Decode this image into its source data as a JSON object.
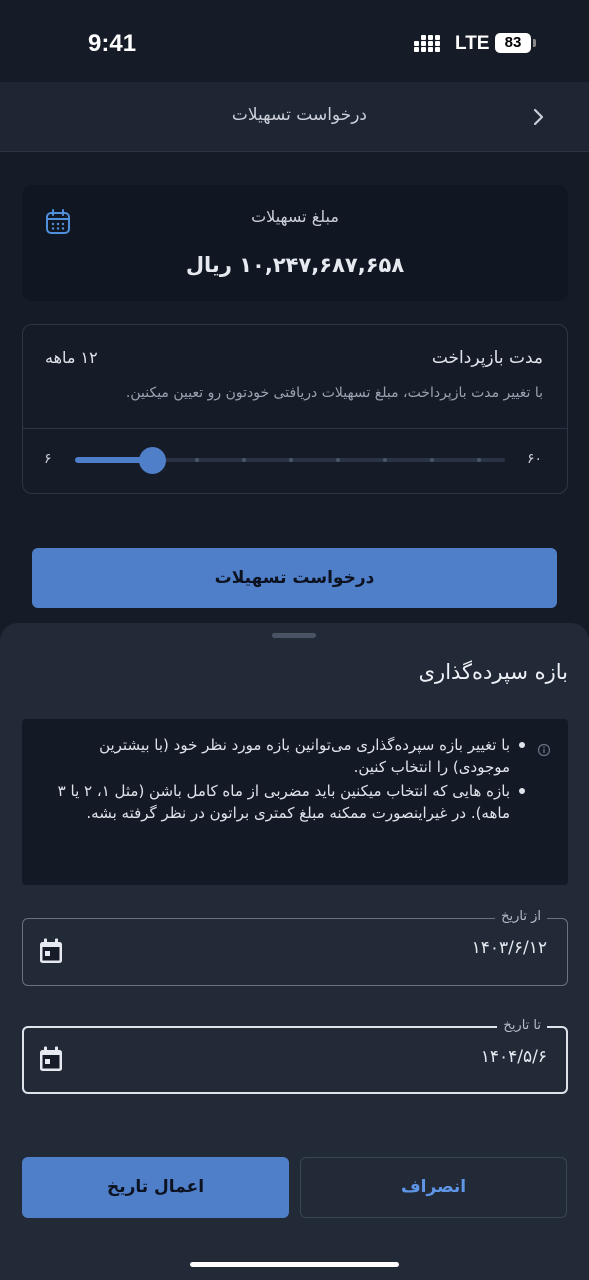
{
  "status_bar": {
    "time": "9:41",
    "network": "LTE",
    "battery": "83"
  },
  "header": {
    "title": "درخواست تسهیلات",
    "back_icon": "chevron-right-icon"
  },
  "amount_card": {
    "label": "مبلغ تسهیلات",
    "value": "۱۰,۲۴۷,۶۸۷,۶۵۸ ریال",
    "icon": "calendar-outline-icon"
  },
  "duration": {
    "title": "مدت بازپرداخت",
    "value": "۱۲ ماهه",
    "description": "با تغییر مدت بازپرداخت، مبلغ تسهیلات دریافتی خودتون رو تعیین میکنین.",
    "slider": {
      "min_label": "۶",
      "max_label": "۶۰",
      "min": 6,
      "max": 60,
      "value": 12
    }
  },
  "request_button": "درخواست تسهیلات",
  "sheet": {
    "title": "بازه سپرده‌گذاری",
    "info_icon": "info-icon",
    "info_items": [
      "با تغییر بازه سپرده‌گذاری می‌توانین بازه مورد نظر خود (با بیشترین موجودی) را انتخاب کنین.",
      "بازه هایی که انتخاب میکنین باید مضربی از ماه کامل باشن (مثل ۱، ۲ یا ۳ ماهه). در غیراینصورت ممکنه مبلغ کمتری براتون در نظر گرفته بشه."
    ],
    "from_date": {
      "label": "از تاریخ",
      "value": "۱۴۰۳/۶/۱۲",
      "icon": "calendar-icon"
    },
    "to_date": {
      "label": "تا تاریخ",
      "value": "۱۴۰۴/۵/۶",
      "icon": "calendar-icon"
    },
    "apply_button": "اعمال تاریخ",
    "cancel_button": "انصراف"
  },
  "colors": {
    "background": "#161c27",
    "sheet": "#222a38",
    "accent": "#4f7fc9",
    "cancel_text": "#5f95e6"
  }
}
